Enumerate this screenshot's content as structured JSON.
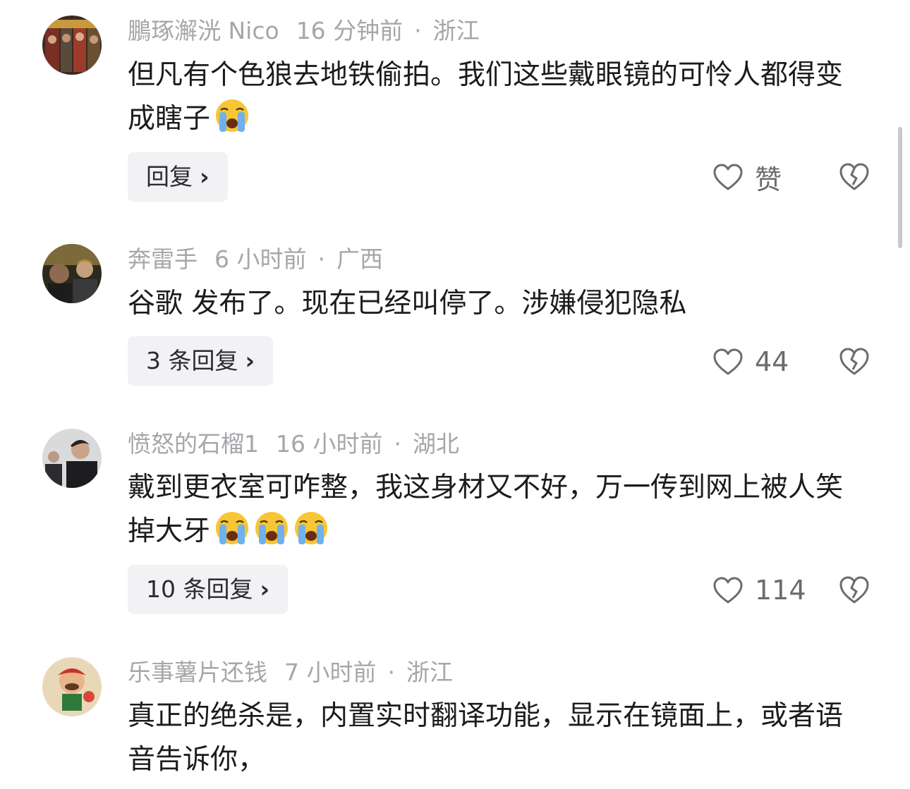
{
  "comments": [
    {
      "username": "鵬琢澥洸 Nico",
      "time": "16 分钟前",
      "location": "浙江",
      "text": "但凡有个色狼去地铁偷拍。我们这些戴眼镜的可怜人都得变成瞎子",
      "emoji": "crying-face",
      "reply_label": "回复",
      "like_label": "赞"
    },
    {
      "username": "奔雷手",
      "time": "6 小时前",
      "location": "广西",
      "text": "谷歌 发布了。现在已经叫停了。涉嫌侵犯隐私",
      "reply_label": "3 条回复",
      "like_label": "44"
    },
    {
      "username": "愤怒的石榴1",
      "time": "16 小时前",
      "location": "湖北",
      "text": "戴到更衣室可咋整，我这身材又不好，万一传到网上被人笑掉大牙",
      "emoji": "crying-face",
      "reply_label": "10 条回复",
      "like_label": "114"
    },
    {
      "username": "乐事薯片还钱",
      "time": "7 小时前",
      "location": "浙江",
      "text": "真正的绝杀是，内置实时翻译功能，显示在镜面上，或者语音告诉你，"
    }
  ],
  "separator": "·",
  "chevron": "›",
  "colors": {
    "meta_text": "#a6a6ab",
    "body_text": "#1c1c1e",
    "reply_bg": "#f2f2f4",
    "icon": "#6b6b70"
  }
}
